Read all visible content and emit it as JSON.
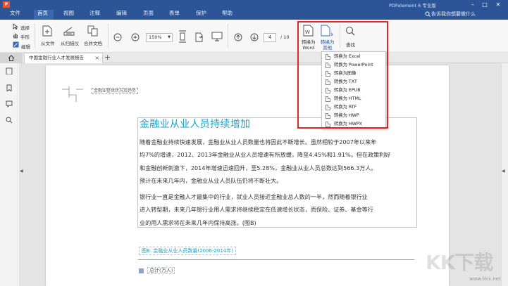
{
  "app": {
    "title": "PDFelement 6 专业版",
    "search_hint": "告诉我你想要做什么"
  },
  "menu": [
    "文件",
    "首页",
    "视图",
    "注释",
    "编辑",
    "页面",
    "表单",
    "保护",
    "帮助"
  ],
  "toolbar": {
    "select_label": "选择",
    "hand_label": "手形",
    "edit_label": "编辑",
    "from_file_label": "从文件",
    "from_scanner_label": "从扫描仪",
    "merge_label": "合并文档",
    "zoom_value": "150%",
    "page_current": "4",
    "page_total": "/ 10",
    "to_word_label": "转换为\nWord",
    "to_other_label": "转换为\n其他",
    "find_label": "查找"
  },
  "tabs": {
    "doc_tab": "中国金融行业人才发展报告"
  },
  "dropdown": [
    "转换为 Excel",
    "转换为 PowerPoint",
    "转换为图像",
    "转换为 TXT",
    "转换为 EPUB",
    "转换为 HTML",
    "转换为 RTF",
    "转换为 HWP",
    "转换为 HWPX"
  ],
  "document": {
    "section_tag": "金融业整体状况及趋势",
    "heading": "金融业从业人员持续增加",
    "para1_lines": [
      "随着金融业持续快速发展，金融业从业人员数量也将因此不断增长。虽然相较于2007年以来年",
      "均7%的增速，2012、2013年金融业从业人员增速有所放缓，降至4.45%和1.91%。但在政策利好",
      "和金融创新刺激下，2014年增速迅速回升，至5.28%，金融业从业人员总数达到566.3万人。",
      "预计在未来几年内，金融业从业人员队伍仍将不断壮大。"
    ],
    "para2_lines": [
      "银行业一直是金融人才最集中的行业，就业人员接近金融业总人数的一半，然而随着银行业",
      "进入转型期，未来几年银行业用人需求将继续稳定在低速增长状态，而保险、证券、基金等行",
      "业的用人需求将在未来几年内保持高涨。(图B)"
    ],
    "caption": "图B: 金融业从业人员数量(2006-2014年)",
    "legend": "总计(万人)"
  },
  "watermark": {
    "logo": "KK下载",
    "url": "www.kkx.net"
  },
  "colors": {
    "menubar": "#2b5597",
    "heading": "#1ba3c6",
    "highlight": "#e0262b"
  }
}
